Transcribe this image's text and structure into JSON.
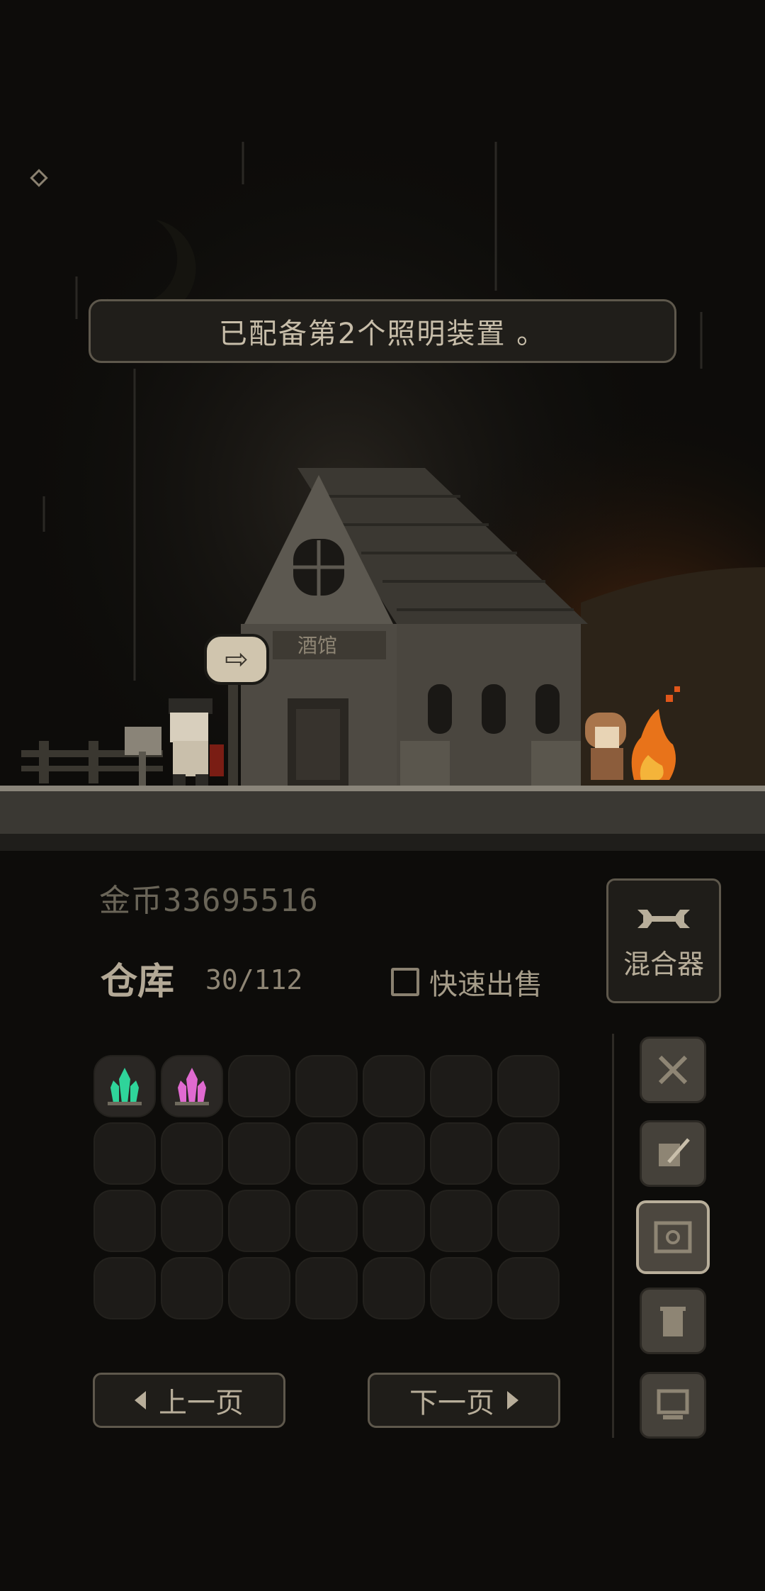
{
  "notice": {
    "text": "已配备第2个照明装置 。"
  },
  "scene": {
    "shop_sign": "酒馆"
  },
  "hud": {
    "gold_text": "金币33695516",
    "warehouse_label": "仓库",
    "warehouse_count": "30/112",
    "quick_sell_label": "快速出售",
    "quick_sell_checked": false
  },
  "mixer": {
    "label": "混合器",
    "icon": "wrench-icon"
  },
  "inventory": {
    "columns": 7,
    "rows": 4,
    "items": [
      {
        "icon": "green-crystal-icon",
        "color": "#2fd49a"
      },
      {
        "icon": "pink-crystal-icon",
        "color": "#e06ad0"
      }
    ]
  },
  "side_menu": [
    {
      "icon": "crossed-swords-icon",
      "active": false
    },
    {
      "icon": "scroll-quill-icon",
      "active": false
    },
    {
      "icon": "safe-icon",
      "active": true
    },
    {
      "icon": "trash-can-icon",
      "active": false
    },
    {
      "icon": "computer-icon",
      "active": false
    }
  ],
  "pagination": {
    "prev_label": "上一页",
    "next_label": "下一页"
  },
  "colors": {
    "bg": "#0d0c0a",
    "panel_border": "#5e584c",
    "text": "#b8ae9a",
    "fire": "#e8731a"
  }
}
